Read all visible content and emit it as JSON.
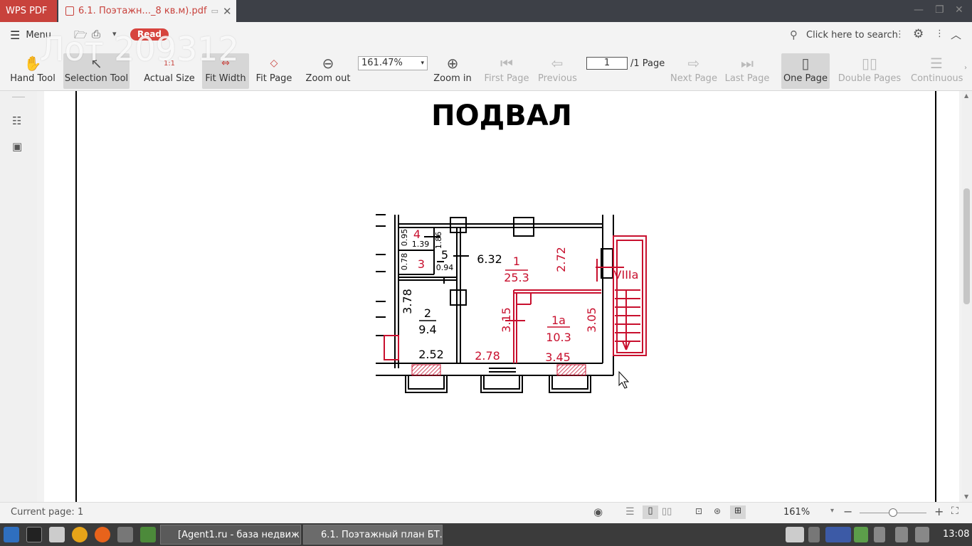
{
  "app": {
    "name": "WPS PDF",
    "tab_title": "6.1. Поэтажн..._8 кв.м).pdf"
  },
  "menubar": {
    "menu_label": "Menu",
    "read_badge": "Read",
    "search_placeholder": "Click here to search"
  },
  "watermark": "Лот 209312",
  "toolbar": {
    "hand": "Hand Tool",
    "selection": "Selection Tool",
    "actual": "Actual Size",
    "fitwidth": "Fit Width",
    "fitpage": "Fit Page",
    "zoomout": "Zoom out",
    "zoom_value": "161.47%",
    "zoomin": "Zoom in",
    "first": "First Page",
    "previous": "Previous",
    "page_value": "1",
    "page_total": "/1 Page",
    "next": "Next Page",
    "last": "Last Page",
    "onepage": "One Page",
    "double": "Double Pages",
    "continuous": "Continuous"
  },
  "plan": {
    "heading": "ПОДВАЛ",
    "rooms": [
      {
        "num": "1",
        "area": "25.3"
      },
      {
        "num": "1а",
        "area": "10.3"
      },
      {
        "num": "2",
        "area": "9.4"
      }
    ],
    "labels": {
      "r4": "4",
      "r3": "3",
      "r5": "5",
      "r2num": "2",
      "r2area": "9.4",
      "d095": "0.95",
      "d139": "1.39",
      "d186": "1.86",
      "d078": "0.78",
      "d094": "0.94",
      "d632": "6.32",
      "d272": "2.72",
      "d378": "3.78",
      "d315": "3.15",
      "d305": "3.05",
      "d252": "2.52",
      "d278": "2.78",
      "d345": "3.45",
      "stair": "VIIIa"
    }
  },
  "status": {
    "current_page": "Current page: 1",
    "zoom": "161%"
  },
  "taskbar": {
    "task1": "[Agent1.ru - база недвиж...",
    "task2": "6.1. Поэтажный план БТ...",
    "clock": "13:08"
  }
}
